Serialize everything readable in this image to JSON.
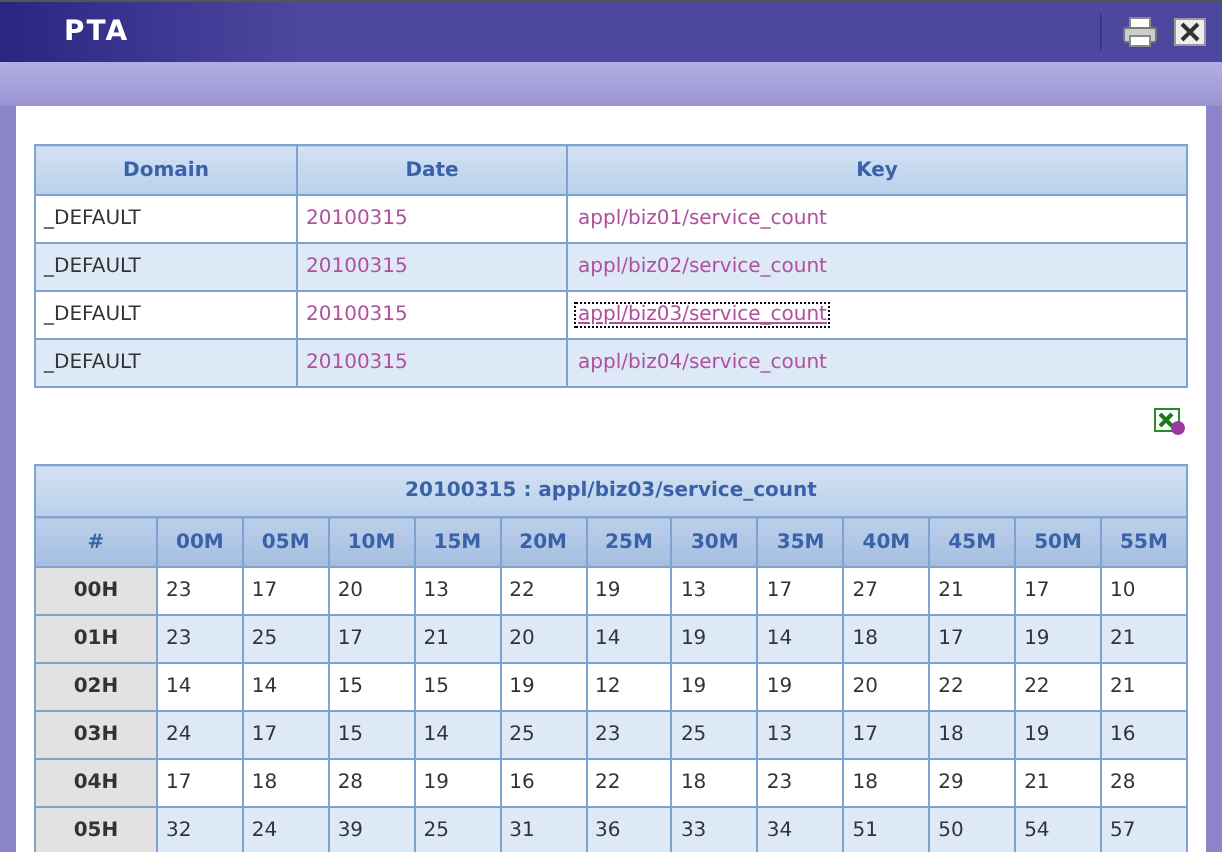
{
  "window": {
    "title": "PTA"
  },
  "keys_table": {
    "columns": [
      "Domain",
      "Date",
      "Key"
    ],
    "rows": [
      {
        "domain": "_DEFAULT",
        "date": "20100315",
        "key": "appl/biz01/service_count",
        "selected": false
      },
      {
        "domain": "_DEFAULT",
        "date": "20100315",
        "key": "appl/biz02/service_count",
        "selected": false
      },
      {
        "domain": "_DEFAULT",
        "date": "20100315",
        "key": "appl/biz03/service_count",
        "selected": true
      },
      {
        "domain": "_DEFAULT",
        "date": "20100315",
        "key": "appl/biz04/service_count",
        "selected": false
      }
    ]
  },
  "counts_table": {
    "title": "20100315 : appl/biz03/service_count",
    "columns": [
      "#",
      "00M",
      "05M",
      "10M",
      "15M",
      "20M",
      "25M",
      "30M",
      "35M",
      "40M",
      "45M",
      "50M",
      "55M"
    ],
    "rows": [
      {
        "hour": "00H",
        "values": [
          "23",
          "17",
          "20",
          "13",
          "22",
          "19",
          "13",
          "17",
          "27",
          "21",
          "17",
          "10"
        ]
      },
      {
        "hour": "01H",
        "values": [
          "23",
          "25",
          "17",
          "21",
          "20",
          "14",
          "19",
          "14",
          "18",
          "17",
          "19",
          "21"
        ]
      },
      {
        "hour": "02H",
        "values": [
          "14",
          "14",
          "15",
          "15",
          "19",
          "12",
          "19",
          "19",
          "20",
          "22",
          "22",
          "21"
        ]
      },
      {
        "hour": "03H",
        "values": [
          "24",
          "17",
          "15",
          "14",
          "25",
          "23",
          "25",
          "13",
          "17",
          "18",
          "19",
          "16"
        ]
      },
      {
        "hour": "04H",
        "values": [
          "17",
          "18",
          "28",
          "19",
          "16",
          "22",
          "18",
          "23",
          "18",
          "29",
          "21",
          "28"
        ]
      },
      {
        "hour": "05H",
        "values": [
          "32",
          "24",
          "39",
          "25",
          "31",
          "36",
          "33",
          "34",
          "51",
          "50",
          "54",
          "57"
        ]
      }
    ]
  }
}
